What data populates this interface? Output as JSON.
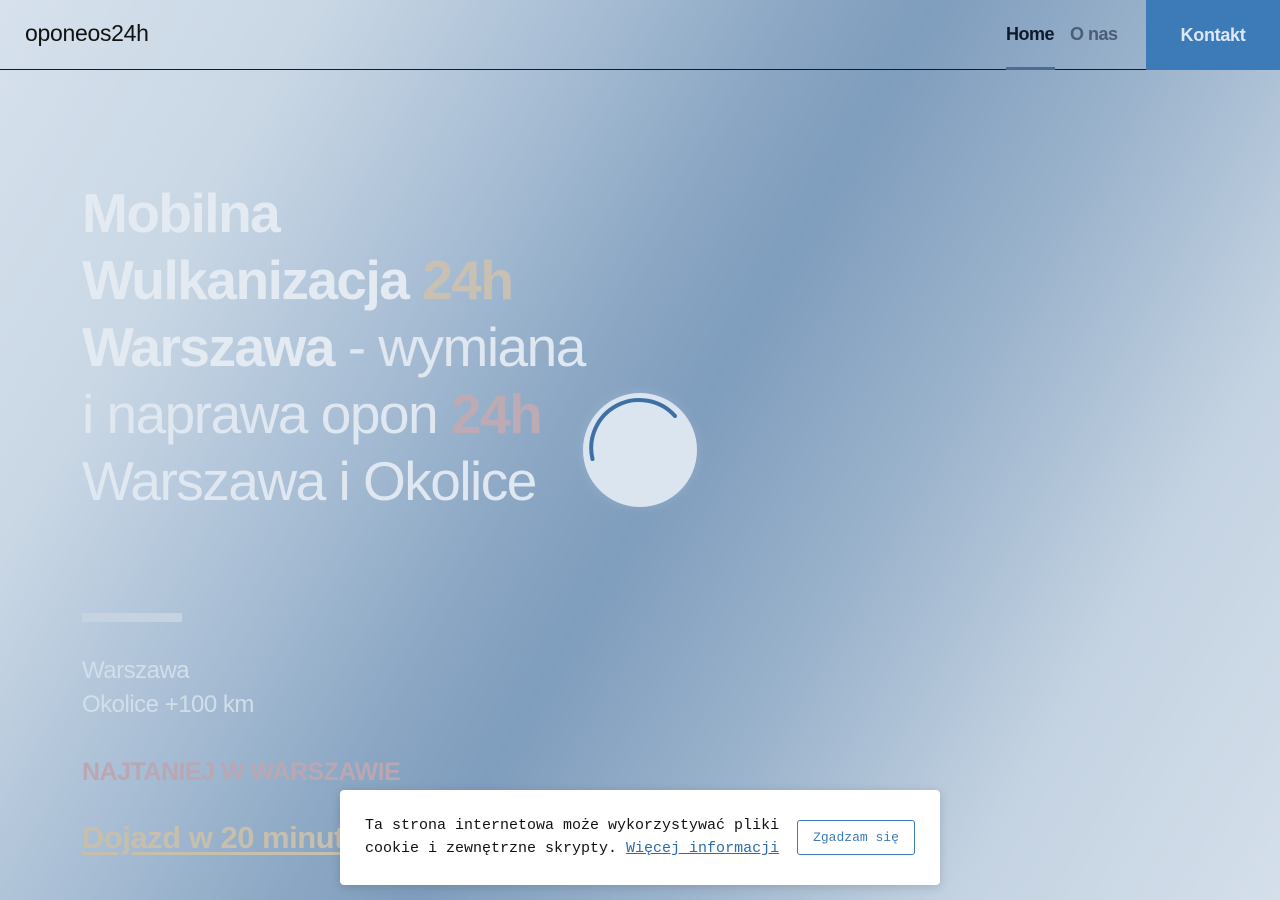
{
  "header": {
    "logo": "oponeos24h",
    "nav": {
      "home": "Home",
      "about": "O nas",
      "contact": "Kontakt"
    }
  },
  "hero": {
    "line1": "Mobilna",
    "line2_main": "Wulkanizacja",
    "line2_accent": "24h",
    "line3_main": "Warszawa",
    "line3_rest": " - wymiana",
    "line4_main": "i naprawa opon",
    "line4_accent": "24h",
    "line5": "Warszawa i Okolice",
    "location_1": "Warszawa",
    "location_2": "Okolice +100 km",
    "cheapest": "NAJTANIEJ W WARSZAWIE",
    "arrival": "Dojazd w 20 minut"
  },
  "cookie_banner": {
    "text": "Ta strona internetowa może wykorzystywać pliki cookie i zewnętrzne skrypty. ",
    "more_info": "Więcej informacji",
    "accept": "Zgadzam się"
  },
  "colors": {
    "accent_blue": "#3d7ab8",
    "hero_text": "#e3eaf2",
    "accent_tan": "#c8c0b3",
    "accent_mauve": "#bcaab4"
  }
}
